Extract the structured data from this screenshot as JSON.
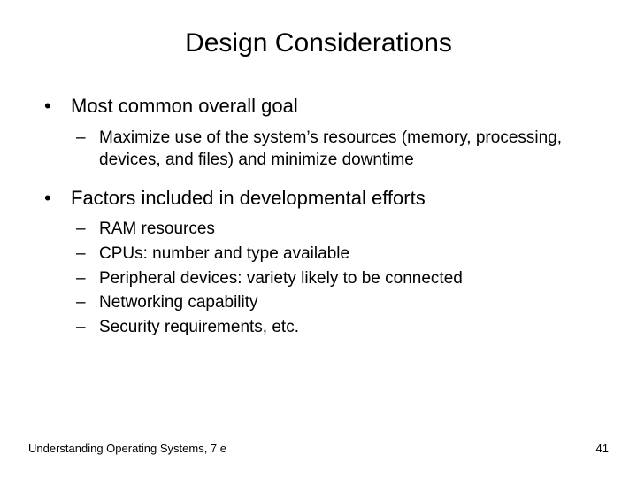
{
  "title": "Design Considerations",
  "items": [
    {
      "label": "Most common overall goal",
      "sub": [
        "Maximize use of the system’s resources (memory, processing, devices, and files) and minimize downtime"
      ]
    },
    {
      "label": "Factors included in developmental efforts",
      "sub": [
        "RAM resources",
        "CPUs: number and type available",
        "Peripheral devices: variety likely to be connected",
        "Networking capability",
        "Security requirements, etc."
      ]
    }
  ],
  "bullet_l1": "•",
  "dash": "–",
  "footer_text": "Understanding Operating Systems, 7 e",
  "page_number": "41"
}
